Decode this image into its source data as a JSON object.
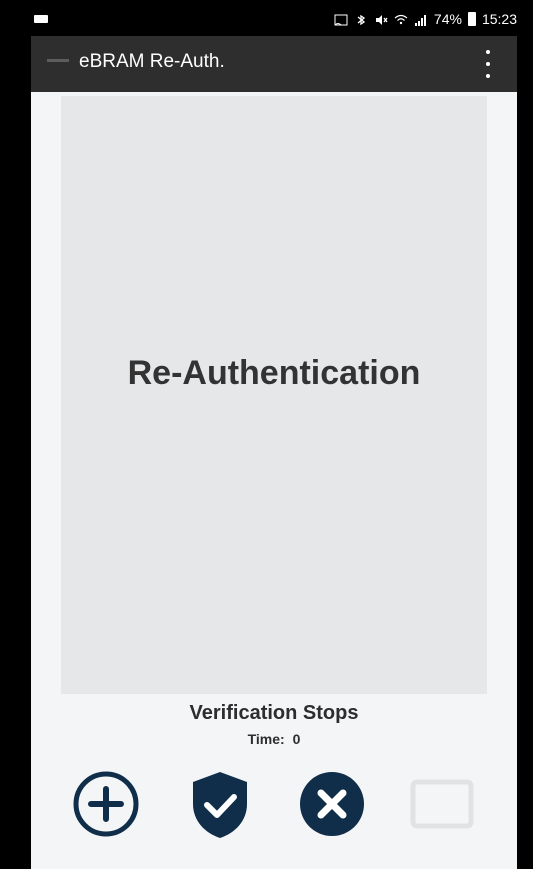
{
  "status_bar": {
    "battery": "74%",
    "time": "15:23"
  },
  "app": {
    "title": "eBRAM Re-Auth."
  },
  "main": {
    "panel_title": "Re-Authentication",
    "status": {
      "line1": "Verification Stops",
      "time_label": "Time:",
      "time_value": "0"
    }
  },
  "actions": {
    "add": "add-circle-icon",
    "accept": "shield-check-icon",
    "reject": "close-circle-icon",
    "placeholder": "blank-rectangle-icon"
  },
  "colors": {
    "primary": "#102E4A",
    "app_bar": "#2E2E2E",
    "panel": "#E6E7E9",
    "background": "#F4F5F7",
    "disabled": "#E1E2E3"
  }
}
